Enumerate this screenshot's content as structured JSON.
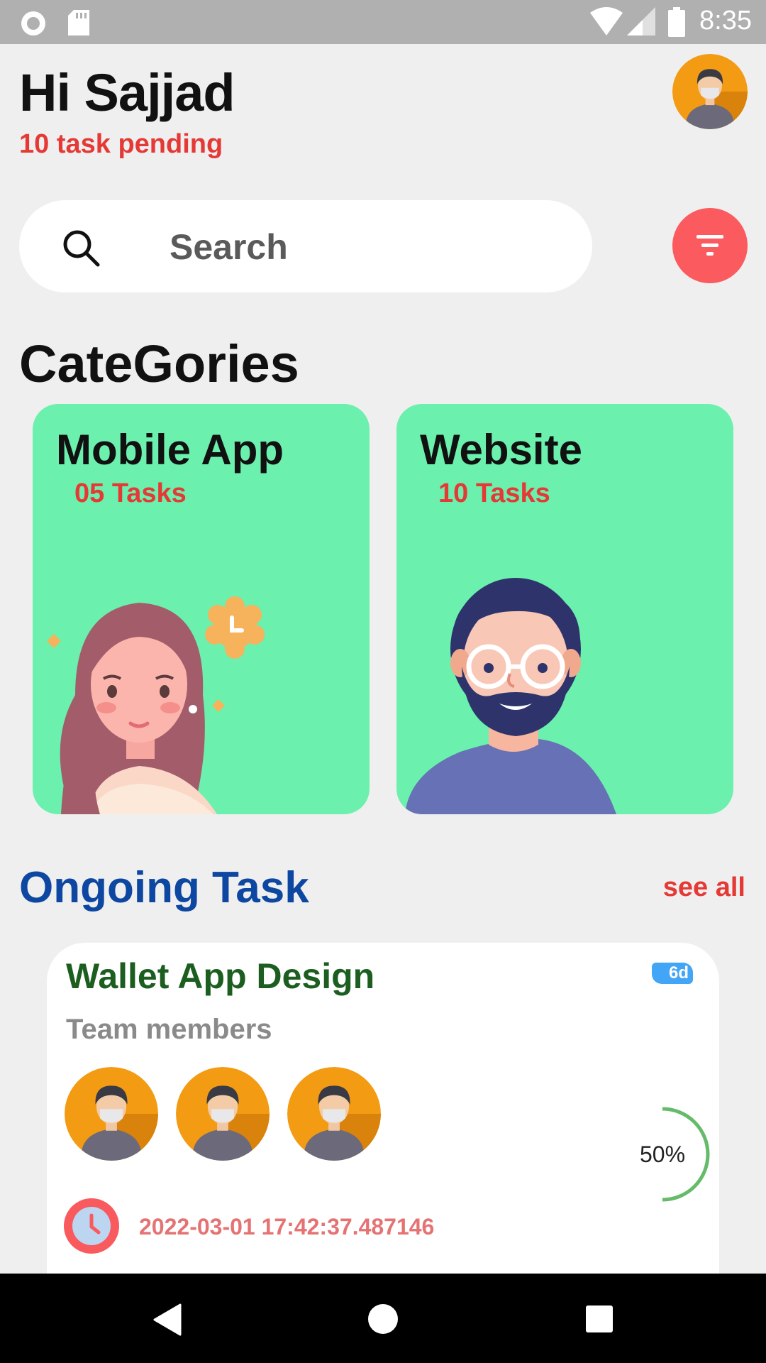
{
  "status_bar": {
    "time": "8:35"
  },
  "header": {
    "greeting": "Hi Sajjad",
    "pending": "10 task pending"
  },
  "search": {
    "placeholder": "Search"
  },
  "categories": {
    "title": "CateGories",
    "items": [
      {
        "name": "Mobile App",
        "count": "05 Tasks"
      },
      {
        "name": "Website",
        "count": "10 Tasks"
      }
    ]
  },
  "ongoing": {
    "title": "Ongoing Task",
    "see_all": "see all",
    "task": {
      "title": "Wallet App Design",
      "days_badge": "6d",
      "team_label": "Team members",
      "progress_label": "50%",
      "progress": 0.5,
      "datetime": "2022-03-01 17:42:37.487146"
    }
  },
  "colors": {
    "accent_red": "#e53935",
    "card_green": "#6bf0ad",
    "title_blue": "#0d47a1",
    "task_green": "#1b5e20",
    "filter_red": "#fb5a5e"
  }
}
